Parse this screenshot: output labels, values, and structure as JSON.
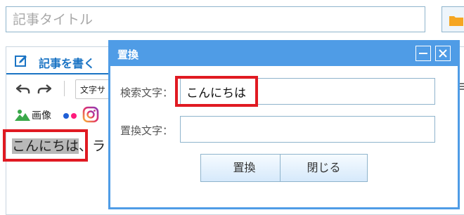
{
  "title_input": {
    "placeholder": "記事タイトル"
  },
  "editor": {
    "header_label": "記事を書く",
    "font_select_value": "文字サ",
    "image_button_label": "画像",
    "content_text": {
      "selected": "こんにちは",
      "rest": "、ラ"
    }
  },
  "dialog": {
    "title": "置換",
    "search_label": "検索文字：",
    "search_value": "こんにちは",
    "replace_label": "置換文字：",
    "replace_value": "",
    "replace_button": "置換",
    "close_button": "閉じる"
  },
  "colors": {
    "accent": "#4f9ce6",
    "header_text": "#1b74c4",
    "highlight_box": "#e01a22",
    "folder": "#f5a623"
  }
}
